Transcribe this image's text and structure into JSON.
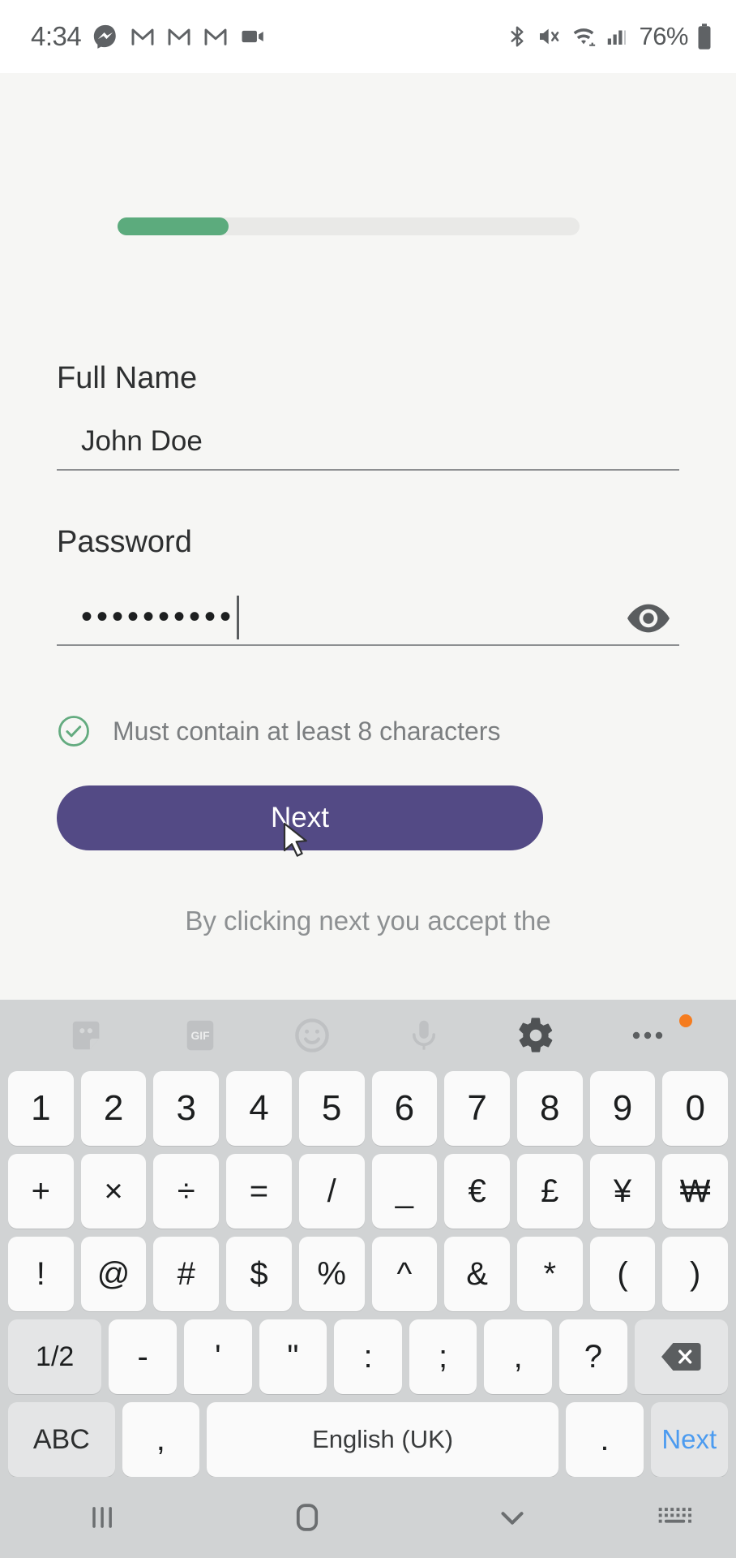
{
  "status_bar": {
    "time": "4:34",
    "battery_percent": "76%",
    "left_icons": [
      "messenger-icon",
      "gmail-icon",
      "gmail-icon",
      "gmail-icon",
      "video-camera-icon"
    ],
    "right_icons": [
      "bluetooth-icon",
      "mute-vibrate-icon",
      "wifi-icon",
      "cellular-signal-icon",
      "battery-icon"
    ]
  },
  "signup": {
    "progress_percent": 24,
    "progress_fill_color": "#5cab7d",
    "progress_track_color": "#e9e9e7",
    "full_name": {
      "label": "Full Name",
      "value": "John Doe"
    },
    "password": {
      "label": "Password",
      "value": "••••••••••",
      "reveal_icon": "eye-icon"
    },
    "hint": {
      "icon": "check-circle-icon",
      "icon_color": "#5cab7d",
      "text": "Must contain at least 8 characters"
    },
    "next_button": {
      "label": "Next",
      "color": "#534a85"
    },
    "terms_text": "By clicking next you accept the"
  },
  "keyboard": {
    "toolbar": [
      {
        "name": "sticker-icon"
      },
      {
        "name": "gif-icon",
        "label": "GIF"
      },
      {
        "name": "emoji-icon"
      },
      {
        "name": "microphone-icon"
      },
      {
        "name": "gear-icon"
      },
      {
        "name": "more-options-icon",
        "badge": true
      }
    ],
    "rows": [
      {
        "keys": [
          {
            "label": "1"
          },
          {
            "label": "2"
          },
          {
            "label": "3"
          },
          {
            "label": "4"
          },
          {
            "label": "5"
          },
          {
            "label": "6"
          },
          {
            "label": "7"
          },
          {
            "label": "8"
          },
          {
            "label": "9"
          },
          {
            "label": "0"
          }
        ]
      },
      {
        "keys": [
          {
            "label": "+"
          },
          {
            "label": "×"
          },
          {
            "label": "÷"
          },
          {
            "label": "="
          },
          {
            "label": "/"
          },
          {
            "label": "_"
          },
          {
            "label": "€"
          },
          {
            "label": "£"
          },
          {
            "label": "¥"
          },
          {
            "label": "₩"
          }
        ]
      },
      {
        "keys": [
          {
            "label": "!"
          },
          {
            "label": "@"
          },
          {
            "label": "#"
          },
          {
            "label": "$"
          },
          {
            "label": "%"
          },
          {
            "label": "^"
          },
          {
            "label": "&"
          },
          {
            "label": "*"
          },
          {
            "label": "("
          },
          {
            "label": ")"
          }
        ]
      },
      {
        "keys": [
          {
            "label": "1/2",
            "style": "gray wide small-txt",
            "name": "page-toggle-key"
          },
          {
            "label": "-"
          },
          {
            "label": "'"
          },
          {
            "label": "\""
          },
          {
            "label": ":"
          },
          {
            "label": ";"
          },
          {
            "label": ","
          },
          {
            "label": "?"
          },
          {
            "label": "",
            "style": "gray wide",
            "name": "backspace-key",
            "icon": "backspace-icon"
          }
        ]
      },
      {
        "keys": [
          {
            "label": "ABC",
            "style": "gray wide abc",
            "name": "abc-key"
          },
          {
            "label": ",",
            "name": "comma-key"
          },
          {
            "label": "English (UK)",
            "style": "space",
            "name": "space-key"
          },
          {
            "label": ".",
            "name": "period-key"
          },
          {
            "label": "Next",
            "style": "gray blue",
            "name": "enter-next-key"
          }
        ]
      }
    ]
  },
  "nav_bar": {
    "items": [
      {
        "name": "recents-icon"
      },
      {
        "name": "home-icon"
      },
      {
        "name": "hide-keyboard-icon"
      },
      {
        "name": "keyboard-switch-icon"
      }
    ]
  }
}
